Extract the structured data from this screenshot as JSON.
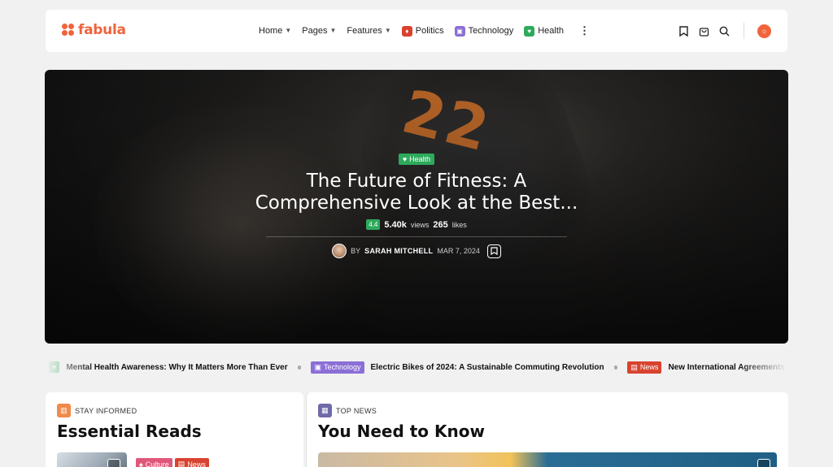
{
  "brand": {
    "name": "fabula",
    "color": "#f0643c"
  },
  "nav": {
    "items": [
      {
        "label": "Home",
        "has_dropdown": true
      },
      {
        "label": "Pages",
        "has_dropdown": true
      },
      {
        "label": "Features",
        "has_dropdown": true
      }
    ],
    "categories": [
      {
        "label": "Politics",
        "icon": "flame-icon",
        "color": "#d8432f"
      },
      {
        "label": "Technology",
        "icon": "chip-icon",
        "color": "#8b6fd6"
      },
      {
        "label": "Health",
        "icon": "heart-icon",
        "color": "#2eaa5c"
      }
    ],
    "more_icon": "more-vertical-icon"
  },
  "header_icons": [
    "bookmark-icon",
    "cart-icon",
    "search-icon",
    "theme-toggle-icon"
  ],
  "hero": {
    "category": "Health",
    "category_color": "#2eaa5c",
    "title": "The Future of Fitness: A Comprehensive Look at the Best...",
    "rating": "4.4",
    "views": "5.40k",
    "views_unit": "views",
    "likes": "265",
    "likes_unit": "likes",
    "by_prefix": "BY",
    "author": "SARAH MITCHELL",
    "date": "MAR 7, 2024",
    "background_digits": "22"
  },
  "ticker": {
    "items": [
      {
        "category": "",
        "title": "Mental Health Awareness: Why It Matters More Than Ever"
      },
      {
        "category": "Technology",
        "color": "#8b6fd6",
        "title": "Electric Bikes of 2024: A Sustainable Commuting Revolution"
      },
      {
        "category": "News",
        "color": "#d8432f",
        "title": "New International Agreements"
      }
    ]
  },
  "sections": {
    "left": {
      "eyebrow": "STAY INFORMED",
      "eyebrow_color": "#f08a4b",
      "title": "Essential Reads",
      "chips": [
        {
          "label": "Culture",
          "color": "#e0577a"
        },
        {
          "label": "News",
          "color": "#d8432f"
        }
      ]
    },
    "right": {
      "eyebrow": "TOP NEWS",
      "eyebrow_color": "#6f6aa8",
      "title": "You Need to Know"
    }
  }
}
